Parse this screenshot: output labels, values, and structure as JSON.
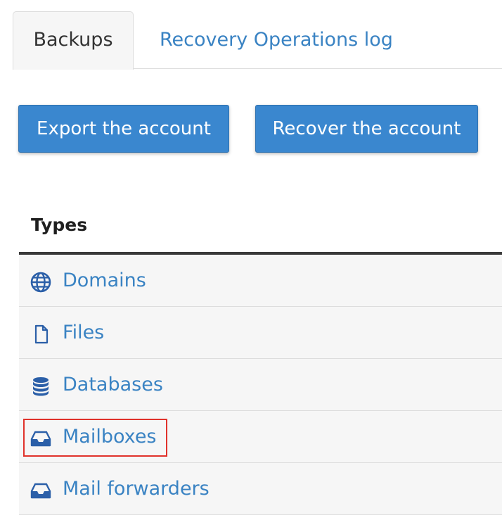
{
  "tabs": {
    "active": "Backups",
    "other": "Recovery Operations log"
  },
  "buttons": {
    "export": "Export the account",
    "recover": "Recover the account"
  },
  "table": {
    "header": "Types",
    "rows": [
      {
        "label": "Domains",
        "icon": "globe-icon"
      },
      {
        "label": "Files",
        "icon": "file-icon"
      },
      {
        "label": "Databases",
        "icon": "database-icon"
      },
      {
        "label": "Mailboxes",
        "icon": "inbox-icon",
        "highlighted": true
      },
      {
        "label": "Mail forwarders",
        "icon": "inbox-icon"
      }
    ]
  },
  "colors": {
    "link": "#3a83c3",
    "button": "#3a87cf",
    "highlight": "#e0322b"
  }
}
